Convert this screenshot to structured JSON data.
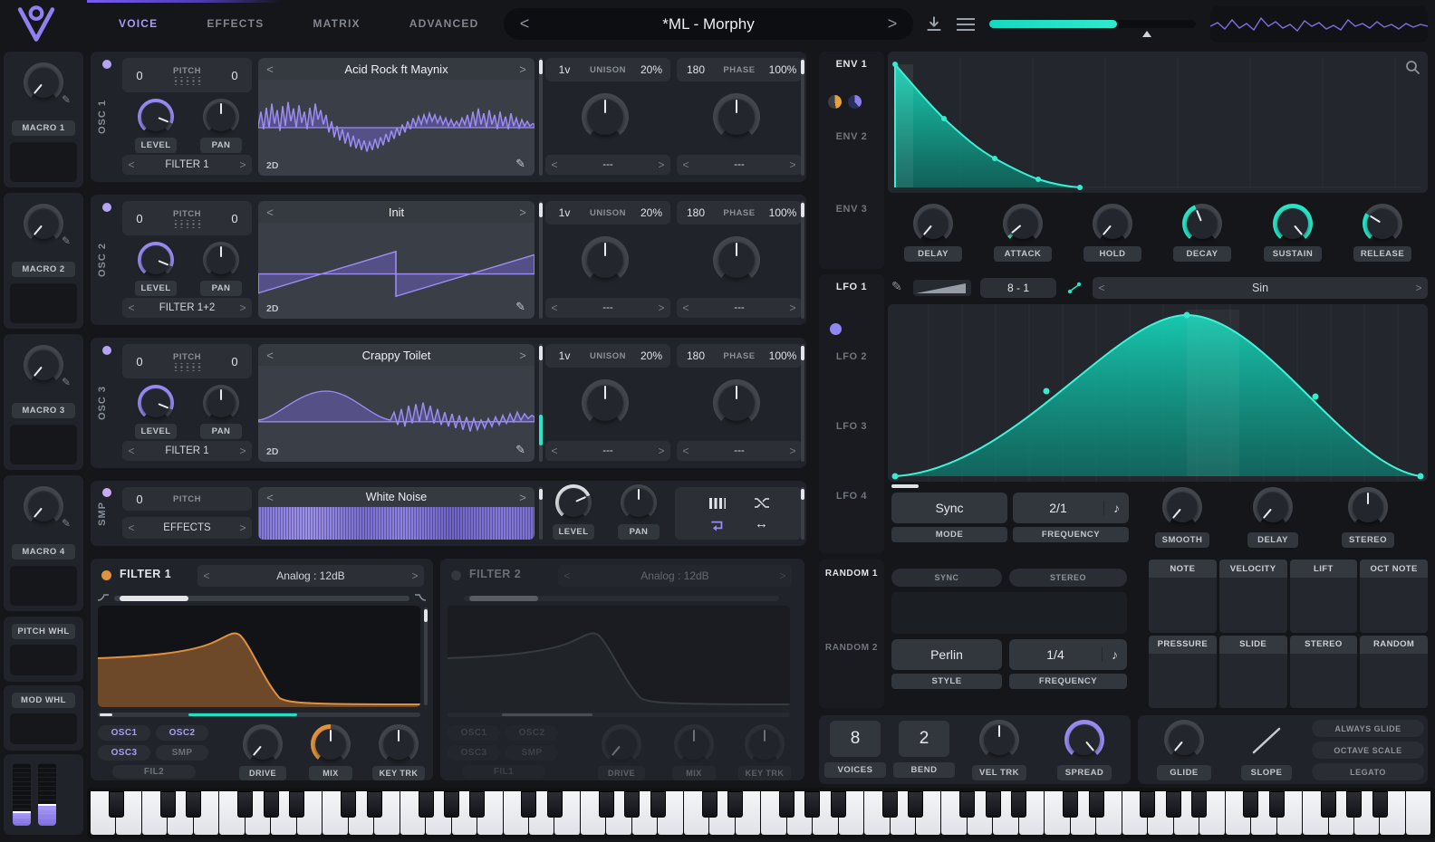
{
  "ui": {
    "prev": "<",
    "next": ">"
  },
  "icons": {
    "pencil": "✎",
    "note": "♪",
    "lr_arrows": "↔"
  },
  "topbar": {
    "tabs": [
      {
        "label": "VOICE",
        "active": true
      },
      {
        "label": "EFFECTS",
        "active": false
      },
      {
        "label": "MATRIX",
        "active": false
      },
      {
        "label": "ADVANCED",
        "active": false
      }
    ],
    "preset_name": "*ML - Morphy"
  },
  "sidebar": {
    "macros": [
      {
        "label": "MACRO 1"
      },
      {
        "label": "MACRO 2"
      },
      {
        "label": "MACRO 3"
      },
      {
        "label": "MACRO 4"
      }
    ],
    "pitch_wheel": "PITCH WHL",
    "mod_wheel": "MOD WHL"
  },
  "oscillators": [
    {
      "name": "OSC 1",
      "pitch_coarse": "0",
      "pitch_label": "PITCH",
      "pitch_fine": "0",
      "level_label": "LEVEL",
      "pan_label": "PAN",
      "route": "FILTER 1",
      "wave_name": "Acid Rock ft Maynix",
      "view": "2D",
      "unison_voices": "1v",
      "unison_label": "UNISON",
      "unison_detune": "20%",
      "unison_dest": "---",
      "phase_value": "180",
      "phase_label": "PHASE",
      "phase_rand": "100%",
      "phase_dest": "---"
    },
    {
      "name": "OSC 2",
      "pitch_coarse": "0",
      "pitch_label": "PITCH",
      "pitch_fine": "0",
      "level_label": "LEVEL",
      "pan_label": "PAN",
      "route": "FILTER 1+2",
      "wave_name": "Init",
      "view": "2D",
      "unison_voices": "1v",
      "unison_label": "UNISON",
      "unison_detune": "20%",
      "unison_dest": "---",
      "phase_value": "180",
      "phase_label": "PHASE",
      "phase_rand": "100%",
      "phase_dest": "---"
    },
    {
      "name": "OSC 3",
      "pitch_coarse": "0",
      "pitch_label": "PITCH",
      "pitch_fine": "0",
      "level_label": "LEVEL",
      "pan_label": "PAN",
      "route": "FILTER 1",
      "wave_name": "Crappy Toilet",
      "view": "2D",
      "unison_voices": "1v",
      "unison_label": "UNISON",
      "unison_detune": "20%",
      "unison_dest": "---",
      "phase_value": "180",
      "phase_label": "PHASE",
      "phase_rand": "100%",
      "phase_dest": "---"
    }
  ],
  "sampler": {
    "name": "SMP",
    "pitch": "0",
    "pitch_label": "PITCH",
    "route": "EFFECTS",
    "sample_name": "White Noise",
    "level_label": "LEVEL",
    "pan_label": "PAN"
  },
  "filters": [
    {
      "title": "FILTER 1",
      "model": "Analog : 12dB",
      "inputs": [
        "OSC1",
        "OSC2",
        "OSC3",
        "SMP"
      ],
      "link": "FIL2",
      "drive_label": "DRIVE",
      "mix_label": "MIX",
      "keytrk_label": "KEY TRK"
    },
    {
      "title": "FILTER 2",
      "model": "Analog : 12dB",
      "inputs": [
        "OSC1",
        "OSC2",
        "OSC3",
        "SMP"
      ],
      "link": "FIL1",
      "drive_label": "DRIVE",
      "mix_label": "MIX",
      "keytrk_label": "KEY TRK"
    }
  ],
  "env": {
    "tabs": [
      "ENV 1",
      "ENV 2",
      "ENV 3"
    ],
    "knobs": [
      "DELAY",
      "ATTACK",
      "HOLD",
      "DECAY",
      "SUSTAIN",
      "RELEASE"
    ]
  },
  "lfo": {
    "tabs": [
      "LFO 1",
      "LFO 2",
      "LFO 3",
      "LFO 4"
    ],
    "range": "8 - 1",
    "shape": "Sin",
    "mode_value": "Sync",
    "mode_label": "MODE",
    "freq_value": "2/1",
    "freq_label": "FREQUENCY",
    "knobs": [
      "SMOOTH",
      "DELAY",
      "STEREO"
    ]
  },
  "random": {
    "tabs": [
      "RANDOM 1",
      "RANDOM 2"
    ],
    "sync": "SYNC",
    "stereo": "STEREO",
    "style_value": "Perlin",
    "style_label": "STYLE",
    "freq_value": "1/4",
    "freq_label": "FREQUENCY"
  },
  "mod_sources": {
    "row1": [
      "NOTE",
      "VELOCITY",
      "LIFT",
      "OCT NOTE"
    ],
    "row2": [
      "PRESSURE",
      "SLIDE",
      "STEREO",
      "RANDOM"
    ]
  },
  "voice": {
    "voices_value": "8",
    "voices_label": "VOICES",
    "bend_value": "2",
    "bend_label": "BEND",
    "veltrk_label": "VEL TRK",
    "spread_label": "SPREAD"
  },
  "glide": {
    "knob_label": "GLIDE",
    "slope_label": "SLOPE",
    "toggles": [
      "ALWAYS GLIDE",
      "OCTAVE SCALE",
      "LEGATO"
    ]
  }
}
